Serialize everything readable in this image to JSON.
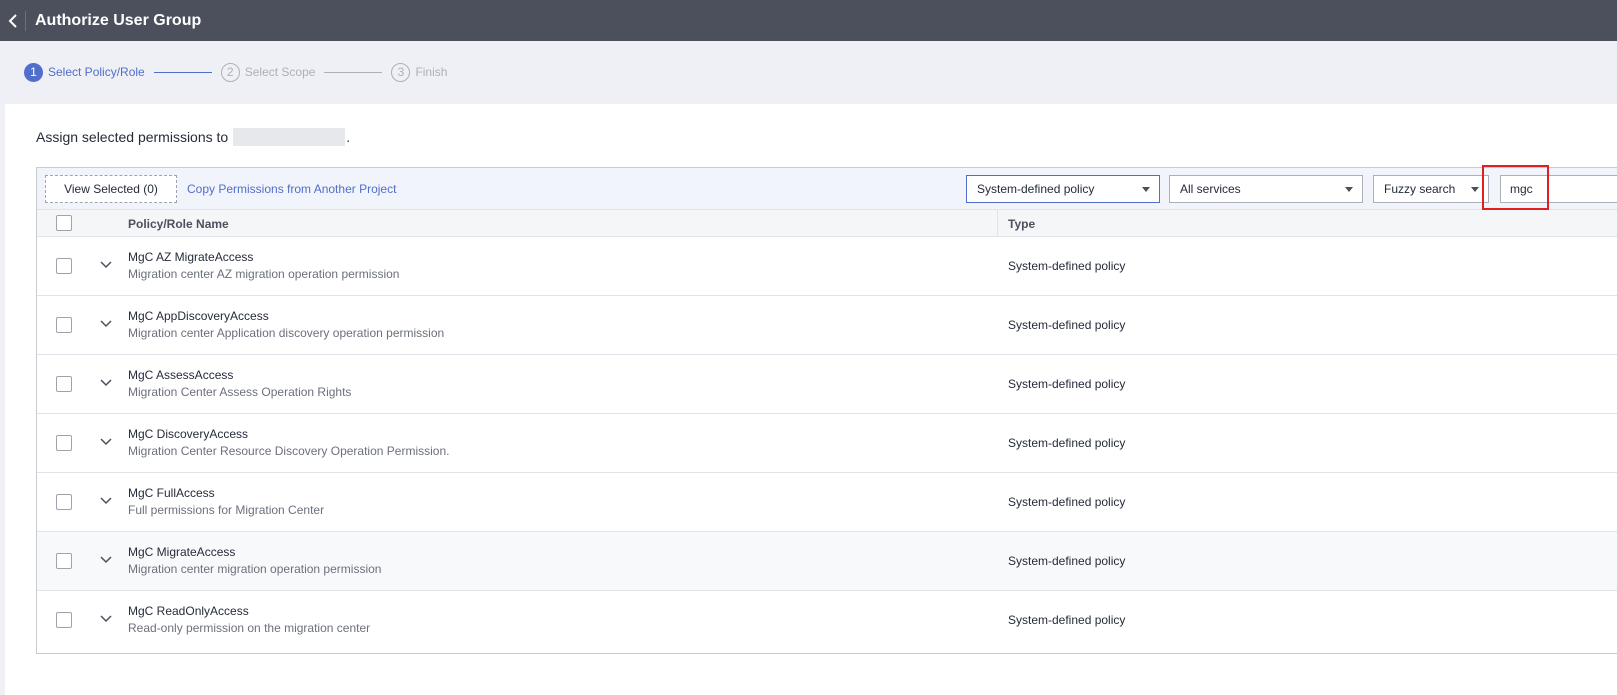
{
  "header": {
    "title": "Authorize User Group"
  },
  "steps": [
    {
      "num": "1",
      "label": "Select Policy/Role",
      "state": "active"
    },
    {
      "num": "2",
      "label": "Select Scope",
      "state": "inactive"
    },
    {
      "num": "3",
      "label": "Finish",
      "state": "inactive"
    }
  ],
  "assign": {
    "prefix": "Assign selected permissions to",
    "suffix": "."
  },
  "toolbar": {
    "view_selected": "View Selected (0)",
    "copy_link": "Copy Permissions from Another Project",
    "policy_filter": "System-defined policy",
    "service_filter": "All services",
    "search_mode": "Fuzzy search",
    "search_value": "mgc"
  },
  "columns": {
    "name": "Policy/Role Name",
    "type": "Type"
  },
  "rows": [
    {
      "name": "MgC AZ MigrateAccess",
      "desc": "Migration center AZ migration operation permission",
      "type": "System-defined policy"
    },
    {
      "name": "MgC AppDiscoveryAccess",
      "desc": "Migration center Application discovery operation permission",
      "type": "System-defined policy"
    },
    {
      "name": "MgC AssessAccess",
      "desc": "Migration Center Assess Operation Rights",
      "type": "System-defined policy"
    },
    {
      "name": "MgC DiscoveryAccess",
      "desc": "Migration Center Resource Discovery Operation Permission.",
      "type": "System-defined policy"
    },
    {
      "name": "MgC FullAccess",
      "desc": "Full permissions for Migration Center",
      "type": "System-defined policy"
    },
    {
      "name": "MgC MigrateAccess",
      "desc": "Migration center migration operation permission",
      "type": "System-defined policy"
    },
    {
      "name": "MgC ReadOnlyAccess",
      "desc": "Read-only permission on the migration center",
      "type": "System-defined policy"
    }
  ],
  "colors": {
    "accent": "#526ecc",
    "topbar": "#4b505c",
    "highlight": "#e02020"
  },
  "icons": {
    "back": "chevron-left-icon",
    "expand": "chevron-down-icon",
    "dropdown": "caret-down-icon"
  }
}
